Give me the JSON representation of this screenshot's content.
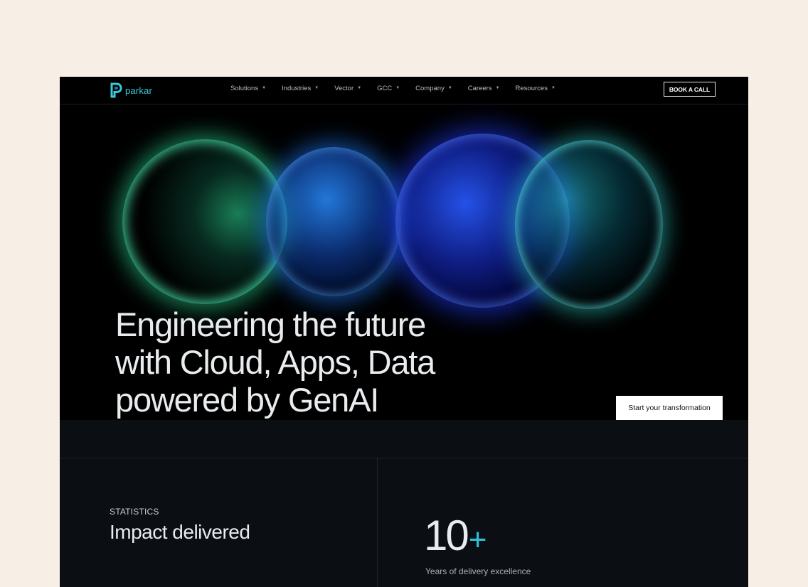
{
  "brand": {
    "name": "parkar",
    "accent_color": "#3bc9db"
  },
  "nav": {
    "items": [
      {
        "label": "Solutions",
        "icon": "chevron-down-icon"
      },
      {
        "label": "Industries",
        "icon": "chevron-down-icon"
      },
      {
        "label": "Vector",
        "icon": "chevron-down-icon"
      },
      {
        "label": "GCC",
        "icon": "chevron-down-icon"
      },
      {
        "label": "Company",
        "icon": "chevron-down-icon"
      },
      {
        "label": "Careers",
        "icon": "chevron-down-icon"
      },
      {
        "label": "Resources",
        "icon": "chevron-down-icon"
      }
    ],
    "cta_label": "BOOK A CALL"
  },
  "hero": {
    "title_lines": [
      "Engineering the future",
      "with Cloud, Apps, Data",
      "powered by GenAI"
    ],
    "cta_label": "Start your transformation",
    "orb_colors": [
      "#2ee59d",
      "#1f7bff",
      "#1f3dff",
      "#2fd6d0"
    ]
  },
  "stats": {
    "kicker": "STATISTICS",
    "heading": "Impact delivered",
    "value": "10",
    "suffix": "+",
    "suffix_color": "#2fc0d6",
    "label": "Years of delivery excellence"
  }
}
